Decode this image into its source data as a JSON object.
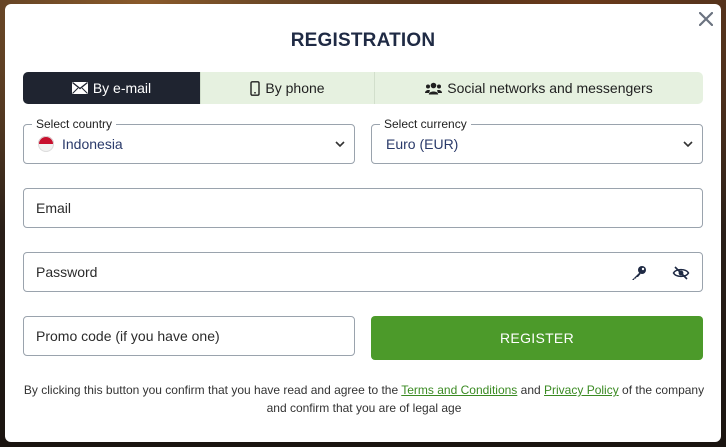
{
  "modal": {
    "title": "REGISTRATION",
    "close_icon": "close-icon"
  },
  "tabs": [
    {
      "label": "By e-mail",
      "icon": "envelope-icon",
      "active": true
    },
    {
      "label": "By phone",
      "icon": "mobile-phone-icon",
      "active": false
    },
    {
      "label": "Social networks and messengers",
      "icon": "users-icon",
      "active": false
    }
  ],
  "country": {
    "label": "Select country",
    "value": "Indonesia",
    "flag_icon": "indonesia-flag-icon"
  },
  "currency": {
    "label": "Select currency",
    "value": "Euro (EUR)"
  },
  "email": {
    "placeholder": "Email"
  },
  "password": {
    "placeholder": "Password",
    "key_icon": "key-icon",
    "eye_icon": "eye-slash-icon"
  },
  "promo": {
    "placeholder": "Promo code (if you have one)"
  },
  "register_label": "REGISTER",
  "legal": {
    "before": "By clicking this button you confirm that you have read and agree to the ",
    "terms": "Terms and Conditions",
    "and": " and ",
    "privacy": "Privacy Policy",
    "after": " of the company and confirm that you are of legal age"
  },
  "colors": {
    "active_tab": "#1f2430",
    "tab_bg": "#e6f1e0",
    "register": "#4c9a2a",
    "title": "#1f2a44",
    "link": "#3a8a22"
  }
}
